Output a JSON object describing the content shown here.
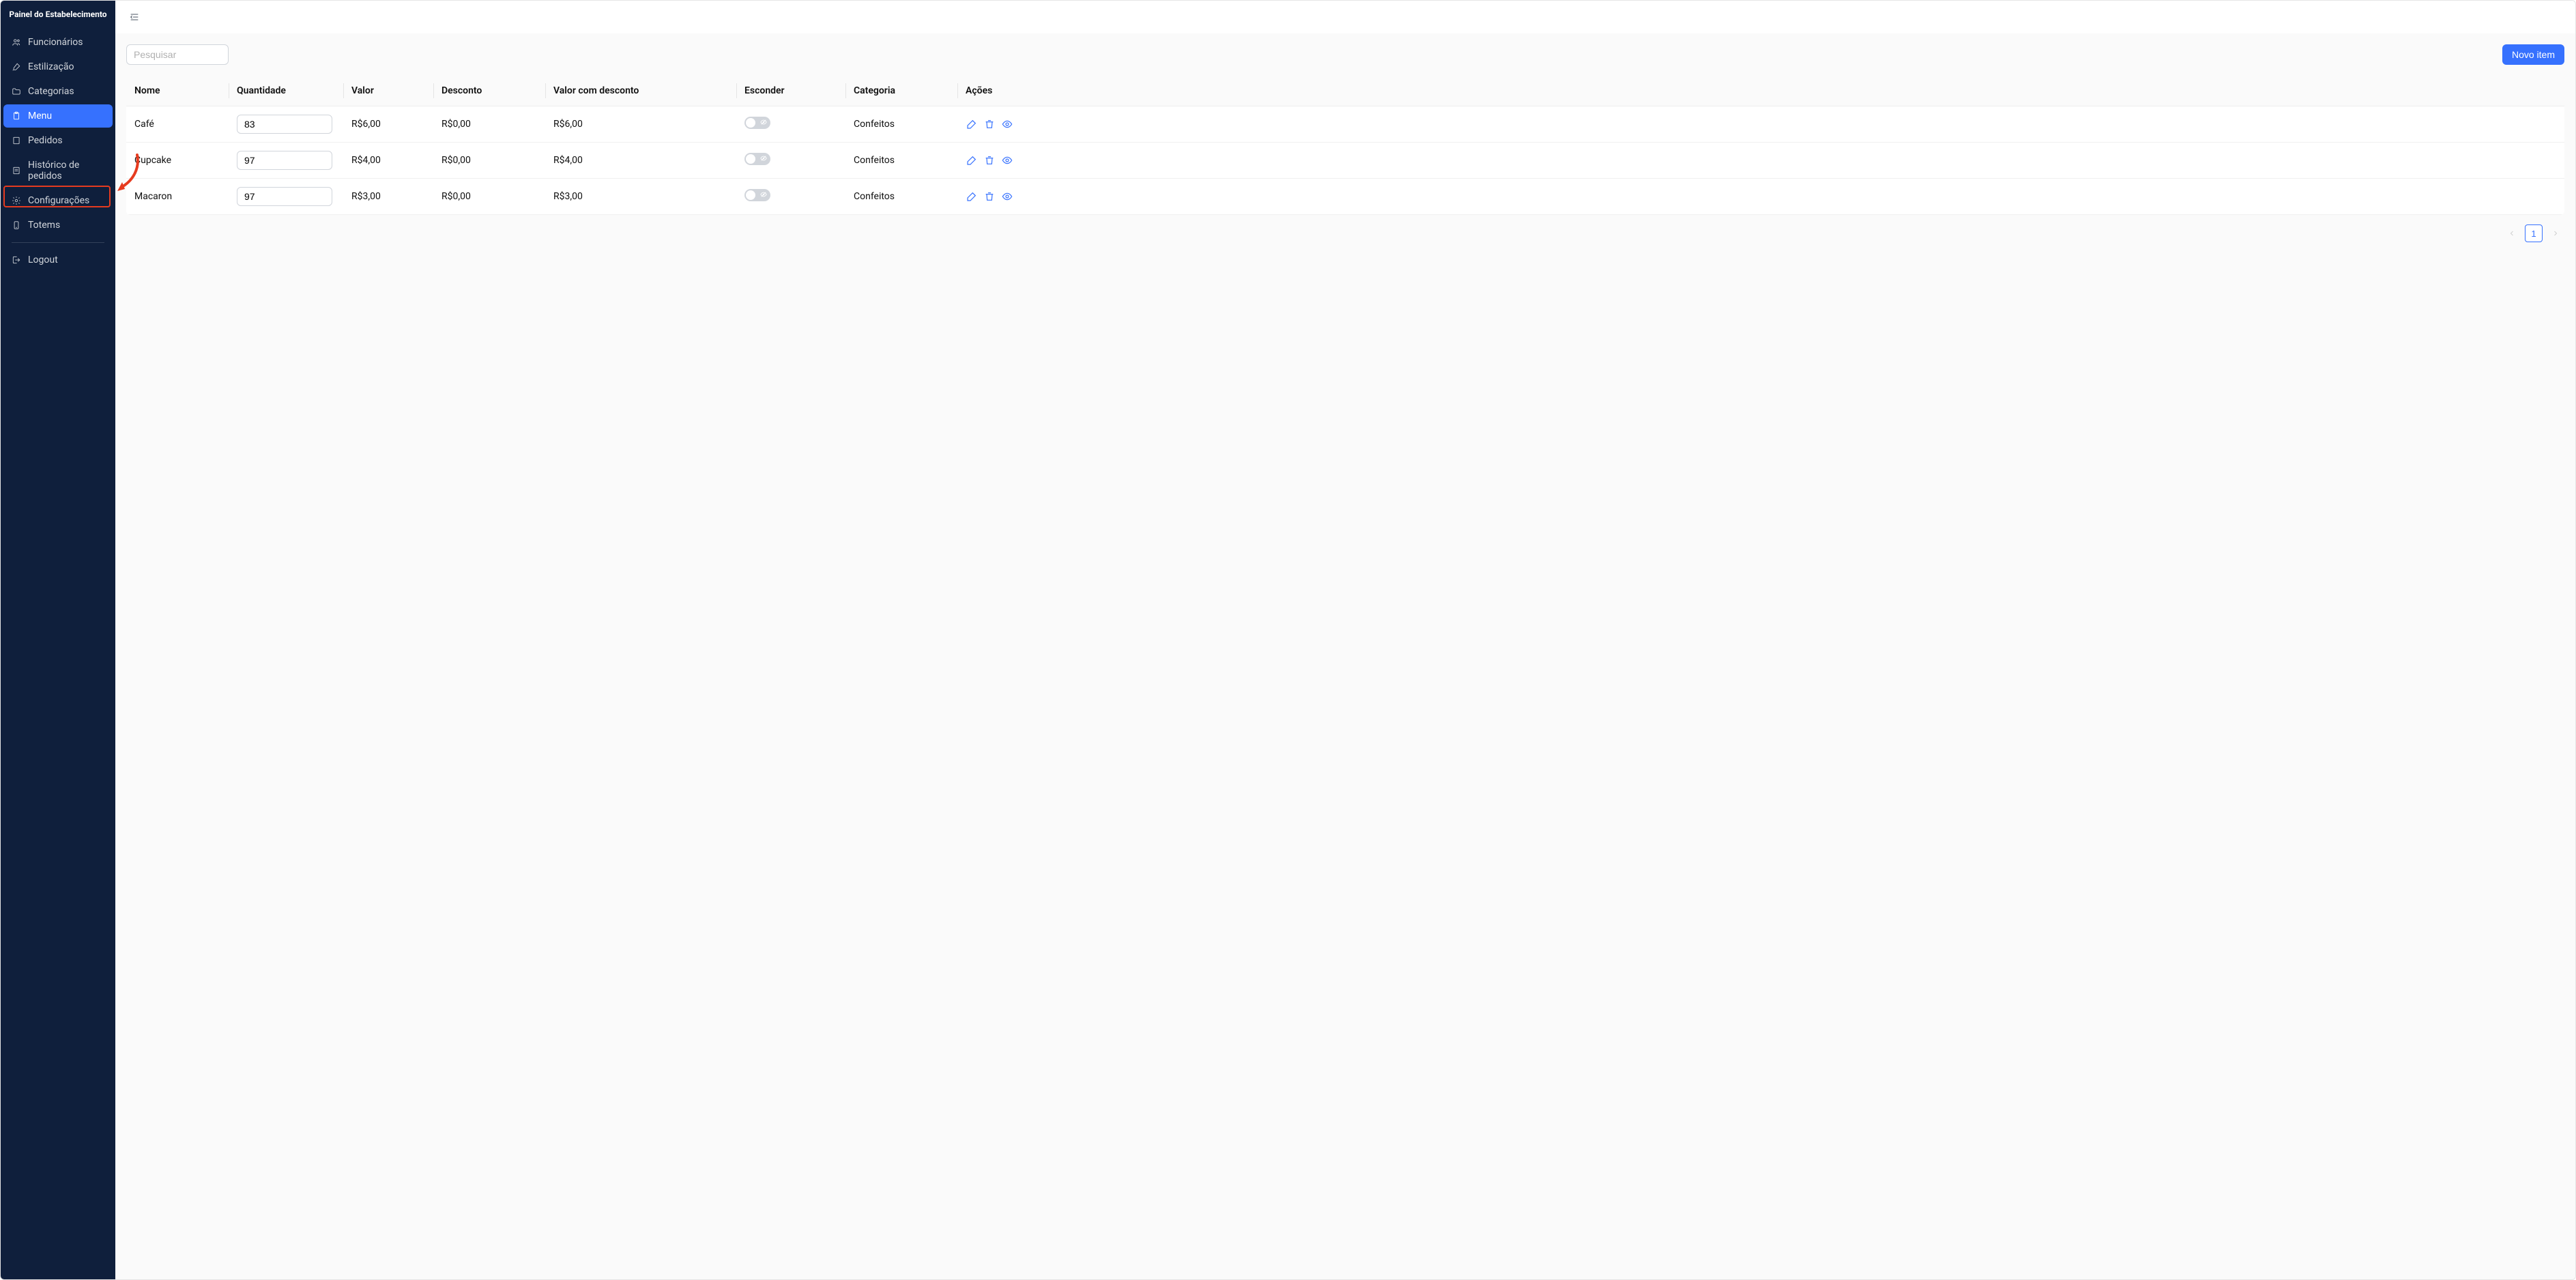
{
  "sidebar": {
    "title": "Painel do Estabelecimento",
    "items": [
      {
        "id": "funcionarios",
        "label": "Funcionários",
        "icon": "users-icon",
        "active": false
      },
      {
        "id": "estilizacao",
        "label": "Estilização",
        "icon": "brush-icon",
        "active": false
      },
      {
        "id": "categorias",
        "label": "Categorias",
        "icon": "folder-icon",
        "active": false
      },
      {
        "id": "menu",
        "label": "Menu",
        "icon": "clipboard-icon",
        "active": true
      },
      {
        "id": "pedidos",
        "label": "Pedidos",
        "icon": "doc-icon",
        "active": false
      },
      {
        "id": "historico",
        "label": "Histórico de pedidos",
        "icon": "doc-lines-icon",
        "active": false
      },
      {
        "id": "configuracoes",
        "label": "Configurações",
        "icon": "gear-icon",
        "active": false
      },
      {
        "id": "totems",
        "label": "Totems",
        "icon": "tablet-icon",
        "active": false
      }
    ],
    "logout": "Logout"
  },
  "toolbar": {
    "search_placeholder": "Pesquisar",
    "new_item_label": "Novo item"
  },
  "table": {
    "headers": {
      "nome": "Nome",
      "quantidade": "Quantidade",
      "valor": "Valor",
      "desconto": "Desconto",
      "valor_com_desconto": "Valor com desconto",
      "esconder": "Esconder",
      "categoria": "Categoria",
      "acoes": "Ações"
    },
    "rows": [
      {
        "nome": "Café",
        "quantidade": "83",
        "valor": "R$6,00",
        "desconto": "R$0,00",
        "valor_com_desconto": "R$6,00",
        "esconder": false,
        "categoria": "Confeitos"
      },
      {
        "nome": "Cupcake",
        "quantidade": "97",
        "valor": "R$4,00",
        "desconto": "R$0,00",
        "valor_com_desconto": "R$4,00",
        "esconder": false,
        "categoria": "Confeitos"
      },
      {
        "nome": "Macaron",
        "quantidade": "97",
        "valor": "R$3,00",
        "desconto": "R$0,00",
        "valor_com_desconto": "R$3,00",
        "esconder": false,
        "categoria": "Confeitos"
      }
    ]
  },
  "pagination": {
    "current": "1"
  }
}
